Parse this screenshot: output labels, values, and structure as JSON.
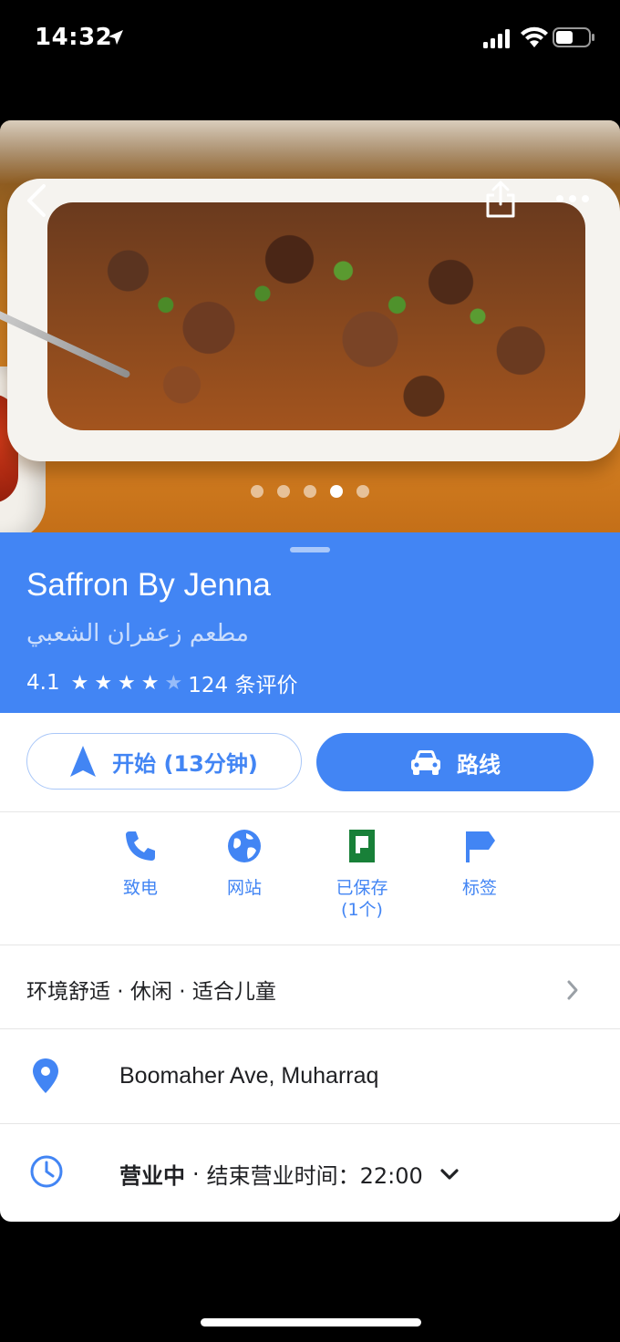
{
  "status_bar": {
    "time": "14:32",
    "icons": [
      "location-arrow-icon",
      "signal-icon",
      "wifi-icon",
      "battery-icon"
    ]
  },
  "hero": {
    "image": "photo of braised meat dish with herbs in white baking dish",
    "page_count": 5,
    "active_page": 4,
    "icons": [
      "back-icon",
      "share-icon",
      "more-icon"
    ]
  },
  "place": {
    "title": "Saffron By Jenna",
    "subtitle": "مطعم زعفران الشعبي",
    "rating_value": "4.1",
    "rating": 4.1,
    "stars_filled": 4,
    "stars_total": 5,
    "reviews_label": "124 条评价"
  },
  "actions": {
    "start_label": "开始 (13分钟)",
    "route_label": "路线"
  },
  "quick_actions": [
    {
      "label": "致电",
      "icon": "phone-icon"
    },
    {
      "label": "网站",
      "icon": "globe-icon"
    },
    {
      "label": "已保存\n(1个)",
      "icon": "saved-flag-icon",
      "line1": "已保存",
      "line2": "(1个)"
    },
    {
      "label": "标签",
      "icon": "label-flag-icon"
    }
  ],
  "attributes": "环境舒适 · 休闲 · 适合儿童",
  "address": "Boomaher Ave, Muharraq",
  "hours": {
    "status": "营业中",
    "separator": "·",
    "detail": "结束营业时间：22:00"
  },
  "colors": {
    "brand_blue": "#4285f4",
    "saved_green": "#188038",
    "text_primary": "#202124"
  }
}
